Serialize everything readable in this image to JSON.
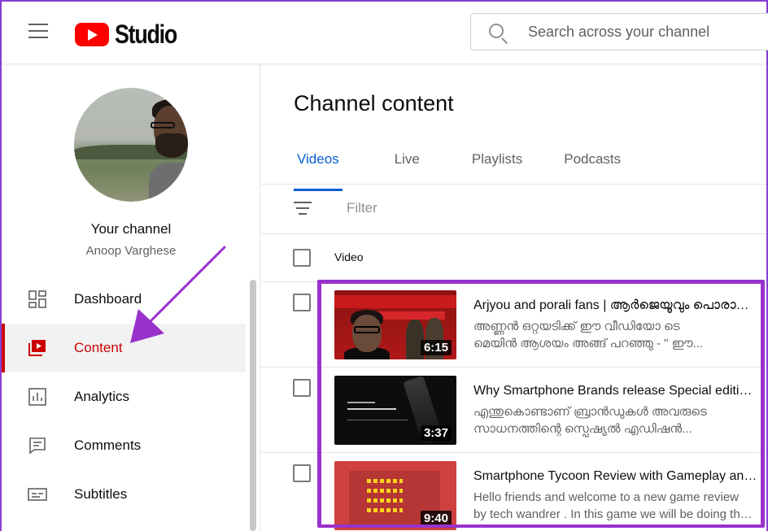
{
  "header": {
    "menu_icon": "hamburger-menu-icon",
    "logo_text": "Studio",
    "search_placeholder": "Search across your channel"
  },
  "sidebar": {
    "channel_title": "Your channel",
    "channel_name": "Anoop Varghese",
    "items": [
      {
        "label": "Dashboard",
        "icon": "dashboard-icon",
        "active": false
      },
      {
        "label": "Content",
        "icon": "content-icon",
        "active": true
      },
      {
        "label": "Analytics",
        "icon": "analytics-icon",
        "active": false
      },
      {
        "label": "Comments",
        "icon": "comments-icon",
        "active": false
      },
      {
        "label": "Subtitles",
        "icon": "subtitles-icon",
        "active": false
      }
    ]
  },
  "main": {
    "title": "Channel content",
    "tabs": [
      {
        "label": "Videos",
        "active": true
      },
      {
        "label": "Live",
        "active": false
      },
      {
        "label": "Playlists",
        "active": false
      },
      {
        "label": "Podcasts",
        "active": false
      }
    ],
    "filter_label": "Filter",
    "column_video": "Video",
    "videos": [
      {
        "title": "Arjyou and porali fans | ആർജെയൂവും പൊരാളി ഫാൻസും | Arjyou",
        "desc_line1": "അണ്ണൻ ഒറ്റയടിക്ക് ഈ വീഡിയോ ടെ",
        "desc_line2": "മെയിൻ ആശയം അങ്ങ് പറഞ്ഞു - \" ഈ...",
        "duration": "6:15"
      },
      {
        "title": "Why Smartphone Brands release Special editions",
        "desc_line1": "എന്തുകൊണ്ടാണ് ബ്രാൻഡുകൾ അവരുടെ",
        "desc_line2": "സാധനത്തിന്റെ സ്പെഷ്യൽ എഡിഷൻ...",
        "duration": "3:37"
      },
      {
        "title": "Smartphone Tycoon Review with Gameplay and tips",
        "desc_line1": "Hello friends and welcome to a new game review",
        "desc_line2": "by tech wandrer . In this game we will be doing the...",
        "duration": "9:40"
      }
    ]
  },
  "colors": {
    "accent_blue": "#065fd4",
    "active_red": "#cc0000",
    "annotation_purple": "#9932cc",
    "logo_red": "#ff0000"
  }
}
